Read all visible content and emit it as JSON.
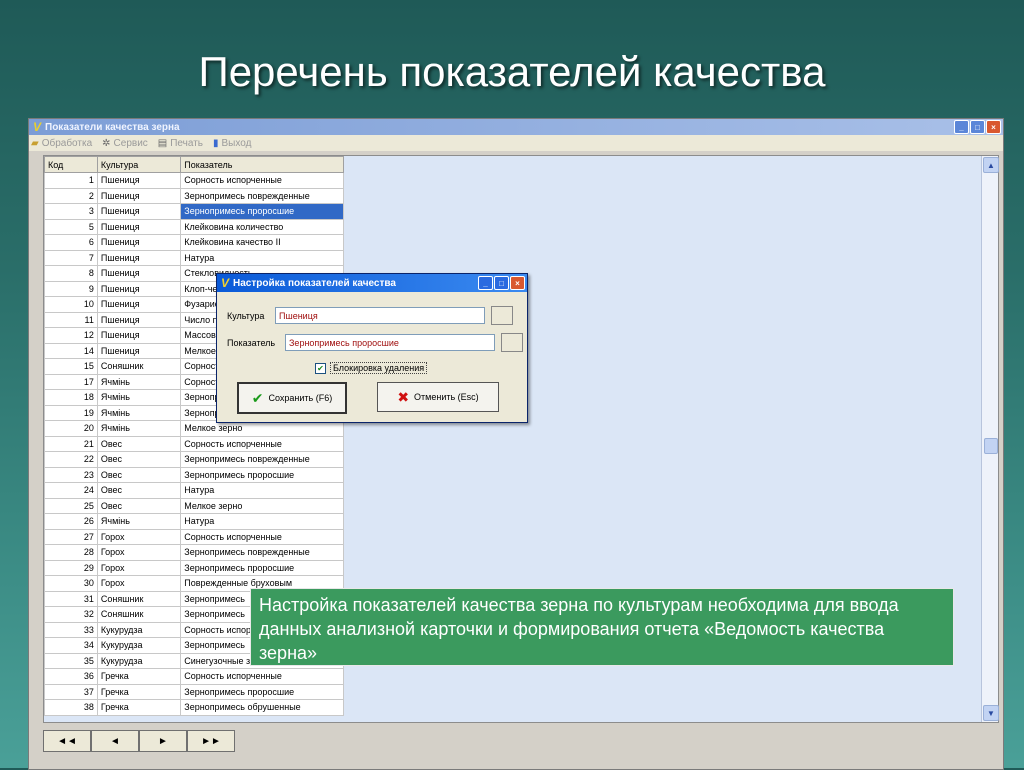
{
  "slide": {
    "title": "Перечень показателей качества"
  },
  "window": {
    "title": "Показатели качества зерна",
    "buttons": {
      "minimize": "_",
      "maximize": "□",
      "close": "×"
    }
  },
  "menu": [
    {
      "label": "Обработка",
      "icon": "folder-icon"
    },
    {
      "label": "Сервис",
      "icon": "gear-icon"
    },
    {
      "label": "Печать",
      "icon": "printer-icon"
    },
    {
      "label": "Выход",
      "icon": "exit-door-icon"
    }
  ],
  "grid": {
    "columns": [
      "Код",
      "Культура",
      "Показатель"
    ],
    "selected_code": "3",
    "rows": [
      [
        "1",
        "Пшениця",
        "Сорность испорченные"
      ],
      [
        "2",
        "Пшениця",
        "Зернопримесь поврежденные"
      ],
      [
        "3",
        "Пшениця",
        "Зернопримесь проросшие"
      ],
      [
        "5",
        "Пшениця",
        "Клейковина количество"
      ],
      [
        "6",
        "Пшениця",
        "Клейковина качество II"
      ],
      [
        "7",
        "Пшениця",
        "Натура"
      ],
      [
        "8",
        "Пшениця",
        "Стекловидность"
      ],
      [
        "9",
        "Пшениця",
        "Клоп-черепашка"
      ],
      [
        "10",
        "Пшениця",
        "Фузариоз"
      ],
      [
        "11",
        "Пшениця",
        "Число падения"
      ],
      [
        "12",
        "Пшениця",
        "Массовая доля белка"
      ],
      [
        "14",
        "Пшениця",
        "Мелкое зерно"
      ],
      [
        "15",
        "Соняшник",
        "Сорность"
      ],
      [
        "17",
        "Ячмінь",
        "Сорность"
      ],
      [
        "18",
        "Ячмінь",
        "Зернопримесь"
      ],
      [
        "19",
        "Ячмінь",
        "Зернопримесь"
      ],
      [
        "20",
        "Ячмінь",
        "Мелкое зерно"
      ],
      [
        "21",
        "Овес",
        "Сорность испорченные"
      ],
      [
        "22",
        "Овес",
        "Зернопримесь поврежденные"
      ],
      [
        "23",
        "Овес",
        "Зернопримесь проросшие"
      ],
      [
        "24",
        "Овес",
        "Натура"
      ],
      [
        "25",
        "Овес",
        "Мелкое зерно"
      ],
      [
        "26",
        "Ячмінь",
        "Натура"
      ],
      [
        "27",
        "Горох",
        "Сорность испорченные"
      ],
      [
        "28",
        "Горох",
        "Зернопримесь поврежденные"
      ],
      [
        "29",
        "Горох",
        "Зернопримесь проросшие"
      ],
      [
        "30",
        "Горох",
        "Поврежденные бруховым"
      ],
      [
        "31",
        "Соняшник",
        "Зернопримесь"
      ],
      [
        "32",
        "Соняшник",
        "Зернопримесь"
      ],
      [
        "33",
        "Кукурудза",
        "Сорность испорченные"
      ],
      [
        "34",
        "Кукурудза",
        "Зернопримесь"
      ],
      [
        "35",
        "Кукурудза",
        "Синегузочные зерна"
      ],
      [
        "36",
        "Гречка",
        "Сорность испорченные"
      ],
      [
        "37",
        "Гречка",
        "Зернопримесь проросшие"
      ],
      [
        "38",
        "Гречка",
        "Зернопримесь обрушенные"
      ]
    ]
  },
  "nav": {
    "first": "◄◄",
    "prev": "◄",
    "next": "►",
    "last": "►►"
  },
  "dialog": {
    "title": "Настройка показателей качества",
    "culture_label": "Культура",
    "culture_value": "Пшениця",
    "indicator_label": "Показатель",
    "indicator_value": "Зернопримесь проросшие",
    "lock_label": "Блокировка удаления",
    "lock_checked": true,
    "save_label": "Сохранить (F6)",
    "cancel_label": "Отменить (Esc)"
  },
  "callout": {
    "text": "Настройка показателей качества зерна по культурам необходима для ввода данных анализной карточки и формирования отчета «Ведомость качества зерна»"
  }
}
